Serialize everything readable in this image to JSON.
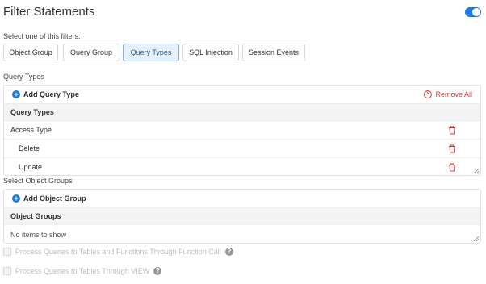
{
  "header": {
    "title": "Filter Statements",
    "toggle_on": true
  },
  "filters": {
    "label": "Select one of this filters:",
    "tabs": [
      {
        "label": "Object Group",
        "active": false
      },
      {
        "label": "Query Group",
        "active": false
      },
      {
        "label": "Query Types",
        "active": true
      },
      {
        "label": "SQL Injection",
        "active": false
      },
      {
        "label": "Session Events",
        "active": false
      }
    ]
  },
  "query_types": {
    "section_label": "Query Types",
    "add_label": "Add Query Type",
    "remove_all_label": "Remove All",
    "column_header": "Query Types",
    "rows": [
      {
        "label": "Access Type"
      },
      {
        "label": "Delete"
      },
      {
        "label": "Update"
      }
    ]
  },
  "object_groups": {
    "section_label": "Select Object Groups",
    "add_label": "Add Object Group",
    "column_header": "Object Groups",
    "empty_text": "No items to show"
  },
  "options": {
    "function_call_label": "Process Queries to Tables and Functions Through Function Call",
    "view_label": "Process Queries to Tables Through VIEW"
  },
  "colors": {
    "accent": "#1f7ae0",
    "danger": "#d43b3b"
  }
}
